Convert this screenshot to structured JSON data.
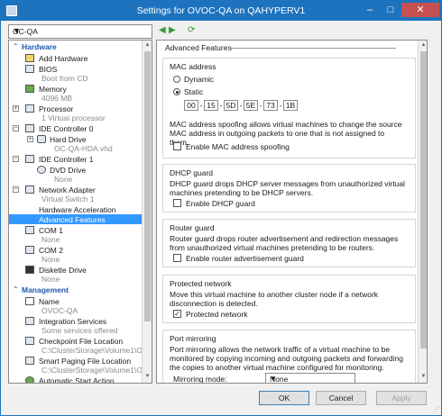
{
  "window": {
    "title": "Settings for OVOC-QA on QAHYPERV1",
    "min": "–",
    "max": "□",
    "close": "✕"
  },
  "vm_selector": {
    "value": "OC-QA"
  },
  "sidebar": {
    "hardware_label": "Hardware",
    "management_label": "Management",
    "items": [
      {
        "name": "Add Hardware",
        "sub": ""
      },
      {
        "name": "BIOS",
        "sub": "Boot from CD"
      },
      {
        "name": "Memory",
        "sub": "4096 MB"
      },
      {
        "name": "Processor",
        "sub": "1 Virtual processor"
      },
      {
        "name": "IDE Controller 0",
        "sub": ""
      },
      {
        "name": "Hard Drive",
        "sub": "OC-QA-HDA.vhd"
      },
      {
        "name": "IDE Controller 1",
        "sub": ""
      },
      {
        "name": "DVD Drive",
        "sub": "None"
      },
      {
        "name": "Network Adapter",
        "sub": "Virtual Switch 1"
      },
      {
        "name": "Hardware Acceleration",
        "sub": ""
      },
      {
        "name": "Advanced Features",
        "sub": ""
      },
      {
        "name": "COM 1",
        "sub": "None"
      },
      {
        "name": "COM 2",
        "sub": "None"
      },
      {
        "name": "Diskette Drive",
        "sub": "None"
      },
      {
        "name": "Name",
        "sub": "OVOC-QA"
      },
      {
        "name": "Integration Services",
        "sub": "Some services offered"
      },
      {
        "name": "Checkpoint File Location",
        "sub": "C:\\ClusterStorage\\Volume1\\OVOC"
      },
      {
        "name": "Smart Paging File Location",
        "sub": "C:\\ClusterStorage\\Volume1\\OVOC"
      },
      {
        "name": "Automatic Start Action",
        "sub": ""
      }
    ]
  },
  "main": {
    "header": "Advanced Features",
    "mac": {
      "title": "MAC address",
      "dynamic": "Dynamic",
      "static": "Static",
      "octets": [
        "00",
        "15",
        "5D",
        "5E",
        "73",
        "1B"
      ],
      "desc": "MAC address spoofing allows virtual machines to change the source MAC address in outgoing packets to one that is not assigned to them.",
      "spoof": "Enable MAC address spoofing"
    },
    "dhcp": {
      "title": "DHCP guard",
      "desc": "DHCP guard drops DHCP server messages from unauthorized virtual machines pretending to be DHCP servers.",
      "check": "Enable DHCP guard"
    },
    "router": {
      "title": "Router guard",
      "desc": "Router guard drops router advertisement and redirection messages from unauthorized virtual machines pretending to be routers.",
      "check": "Enable router advertisement guard"
    },
    "protected": {
      "title": "Protected network",
      "desc": "Move this virtual machine to another cluster node if a network disconnection is detected.",
      "check": "Protected network"
    },
    "mirror": {
      "title": "Port mirroring",
      "desc": "Port mirroring allows the network traffic of a virtual machine to be monitored by copying incoming and outgoing packets and forwarding the copies to another virtual machine configured for monitoring.",
      "mode_label": "Mirroring mode:",
      "mode_value": "None"
    }
  },
  "buttons": {
    "ok": "OK",
    "cancel": "Cancel",
    "apply": "Apply"
  }
}
